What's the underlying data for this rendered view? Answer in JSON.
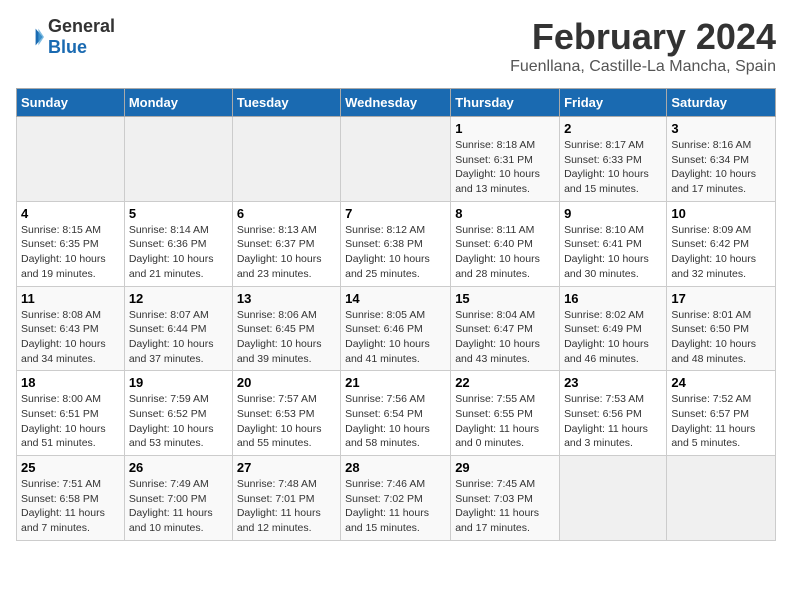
{
  "header": {
    "logo_line1": "General",
    "logo_line2": "Blue",
    "month_title": "February 2024",
    "location": "Fuenllana, Castille-La Mancha, Spain"
  },
  "days_of_week": [
    "Sunday",
    "Monday",
    "Tuesday",
    "Wednesday",
    "Thursday",
    "Friday",
    "Saturday"
  ],
  "weeks": [
    [
      {
        "day": "",
        "info": ""
      },
      {
        "day": "",
        "info": ""
      },
      {
        "day": "",
        "info": ""
      },
      {
        "day": "",
        "info": ""
      },
      {
        "day": "1",
        "info": "Sunrise: 8:18 AM\nSunset: 6:31 PM\nDaylight: 10 hours\nand 13 minutes."
      },
      {
        "day": "2",
        "info": "Sunrise: 8:17 AM\nSunset: 6:33 PM\nDaylight: 10 hours\nand 15 minutes."
      },
      {
        "day": "3",
        "info": "Sunrise: 8:16 AM\nSunset: 6:34 PM\nDaylight: 10 hours\nand 17 minutes."
      }
    ],
    [
      {
        "day": "4",
        "info": "Sunrise: 8:15 AM\nSunset: 6:35 PM\nDaylight: 10 hours\nand 19 minutes."
      },
      {
        "day": "5",
        "info": "Sunrise: 8:14 AM\nSunset: 6:36 PM\nDaylight: 10 hours\nand 21 minutes."
      },
      {
        "day": "6",
        "info": "Sunrise: 8:13 AM\nSunset: 6:37 PM\nDaylight: 10 hours\nand 23 minutes."
      },
      {
        "day": "7",
        "info": "Sunrise: 8:12 AM\nSunset: 6:38 PM\nDaylight: 10 hours\nand 25 minutes."
      },
      {
        "day": "8",
        "info": "Sunrise: 8:11 AM\nSunset: 6:40 PM\nDaylight: 10 hours\nand 28 minutes."
      },
      {
        "day": "9",
        "info": "Sunrise: 8:10 AM\nSunset: 6:41 PM\nDaylight: 10 hours\nand 30 minutes."
      },
      {
        "day": "10",
        "info": "Sunrise: 8:09 AM\nSunset: 6:42 PM\nDaylight: 10 hours\nand 32 minutes."
      }
    ],
    [
      {
        "day": "11",
        "info": "Sunrise: 8:08 AM\nSunset: 6:43 PM\nDaylight: 10 hours\nand 34 minutes."
      },
      {
        "day": "12",
        "info": "Sunrise: 8:07 AM\nSunset: 6:44 PM\nDaylight: 10 hours\nand 37 minutes."
      },
      {
        "day": "13",
        "info": "Sunrise: 8:06 AM\nSunset: 6:45 PM\nDaylight: 10 hours\nand 39 minutes."
      },
      {
        "day": "14",
        "info": "Sunrise: 8:05 AM\nSunset: 6:46 PM\nDaylight: 10 hours\nand 41 minutes."
      },
      {
        "day": "15",
        "info": "Sunrise: 8:04 AM\nSunset: 6:47 PM\nDaylight: 10 hours\nand 43 minutes."
      },
      {
        "day": "16",
        "info": "Sunrise: 8:02 AM\nSunset: 6:49 PM\nDaylight: 10 hours\nand 46 minutes."
      },
      {
        "day": "17",
        "info": "Sunrise: 8:01 AM\nSunset: 6:50 PM\nDaylight: 10 hours\nand 48 minutes."
      }
    ],
    [
      {
        "day": "18",
        "info": "Sunrise: 8:00 AM\nSunset: 6:51 PM\nDaylight: 10 hours\nand 51 minutes."
      },
      {
        "day": "19",
        "info": "Sunrise: 7:59 AM\nSunset: 6:52 PM\nDaylight: 10 hours\nand 53 minutes."
      },
      {
        "day": "20",
        "info": "Sunrise: 7:57 AM\nSunset: 6:53 PM\nDaylight: 10 hours\nand 55 minutes."
      },
      {
        "day": "21",
        "info": "Sunrise: 7:56 AM\nSunset: 6:54 PM\nDaylight: 10 hours\nand 58 minutes."
      },
      {
        "day": "22",
        "info": "Sunrise: 7:55 AM\nSunset: 6:55 PM\nDaylight: 11 hours\nand 0 minutes."
      },
      {
        "day": "23",
        "info": "Sunrise: 7:53 AM\nSunset: 6:56 PM\nDaylight: 11 hours\nand 3 minutes."
      },
      {
        "day": "24",
        "info": "Sunrise: 7:52 AM\nSunset: 6:57 PM\nDaylight: 11 hours\nand 5 minutes."
      }
    ],
    [
      {
        "day": "25",
        "info": "Sunrise: 7:51 AM\nSunset: 6:58 PM\nDaylight: 11 hours\nand 7 minutes."
      },
      {
        "day": "26",
        "info": "Sunrise: 7:49 AM\nSunset: 7:00 PM\nDaylight: 11 hours\nand 10 minutes."
      },
      {
        "day": "27",
        "info": "Sunrise: 7:48 AM\nSunset: 7:01 PM\nDaylight: 11 hours\nand 12 minutes."
      },
      {
        "day": "28",
        "info": "Sunrise: 7:46 AM\nSunset: 7:02 PM\nDaylight: 11 hours\nand 15 minutes."
      },
      {
        "day": "29",
        "info": "Sunrise: 7:45 AM\nSunset: 7:03 PM\nDaylight: 11 hours\nand 17 minutes."
      },
      {
        "day": "",
        "info": ""
      },
      {
        "day": "",
        "info": ""
      }
    ]
  ]
}
